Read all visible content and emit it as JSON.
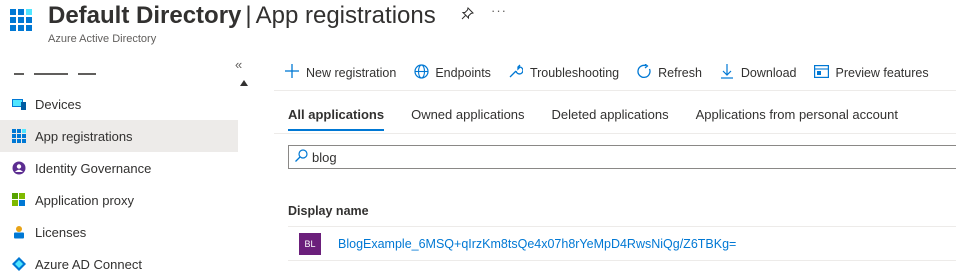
{
  "header": {
    "title": "Default Directory",
    "separator": "|",
    "page": "App registrations",
    "subtitle": "Azure Active Directory",
    "pin_icon": "pin-icon",
    "more_icon": "more-icon",
    "more_glyph": "···"
  },
  "sidebar": {
    "collapse_glyph": "«",
    "items": [
      {
        "label": "Devices",
        "icon": "devices-icon"
      },
      {
        "label": "App registrations",
        "icon": "app-registrations-icon",
        "active": true
      },
      {
        "label": "Identity Governance",
        "icon": "identity-governance-icon"
      },
      {
        "label": "Application proxy",
        "icon": "application-proxy-icon"
      },
      {
        "label": "Licenses",
        "icon": "licenses-icon"
      },
      {
        "label": "Azure AD Connect",
        "icon": "azure-ad-connect-icon"
      }
    ]
  },
  "toolbar": {
    "new_registration": "New registration",
    "endpoints": "Endpoints",
    "troubleshooting": "Troubleshooting",
    "refresh": "Refresh",
    "download": "Download",
    "preview_features": "Preview features"
  },
  "tabs": {
    "all": "All applications",
    "owned": "Owned applications",
    "deleted": "Deleted applications",
    "personal": "Applications from personal account"
  },
  "search": {
    "value": "blog"
  },
  "table": {
    "column_display_name": "Display name",
    "rows": [
      {
        "initials": "BL",
        "name": "BlogExample_6MSQ+qIrzKm8tsQe4x07h8rYeMpD4RwsNiQg/Z6TBKg="
      }
    ]
  },
  "colors": {
    "accent": "#0078d4",
    "badge": "#6b1f7b",
    "active_nav": "#edebe9"
  }
}
